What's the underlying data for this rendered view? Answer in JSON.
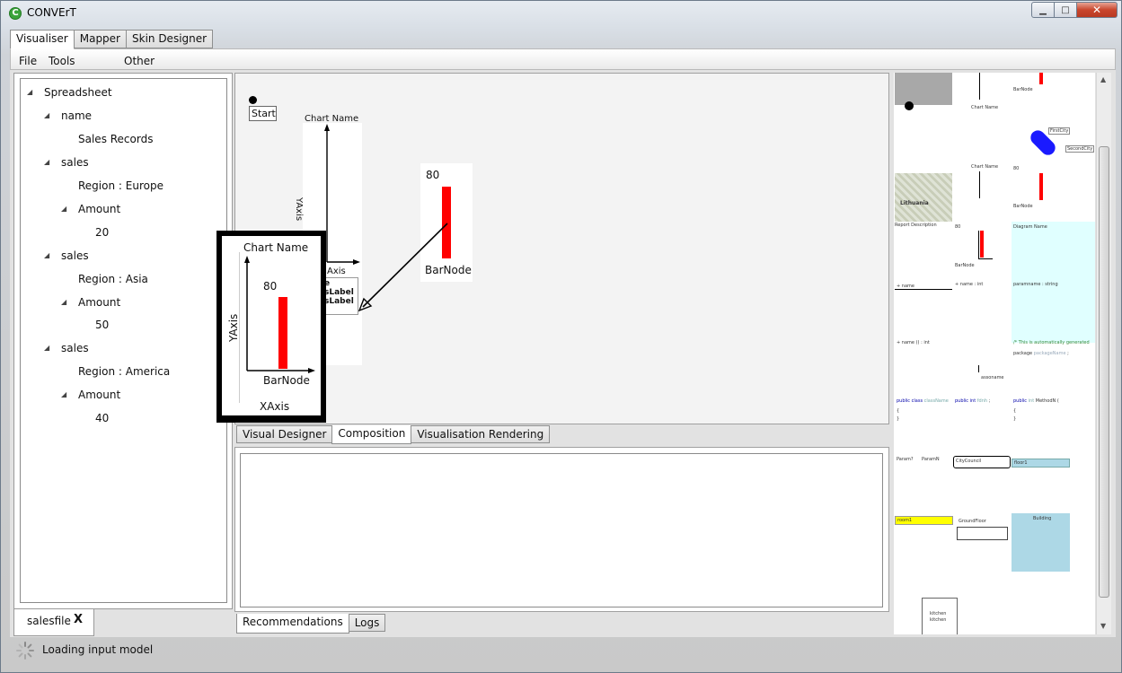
{
  "window": {
    "title": "CONVErT",
    "app_icon": "C"
  },
  "top_tabs": [
    {
      "label": "Visualiser"
    },
    {
      "label": "Mapper"
    },
    {
      "label": "Skin Designer"
    }
  ],
  "menu": [
    {
      "label": "File"
    },
    {
      "label": "Tools"
    },
    {
      "label": "Other"
    }
  ],
  "tree": {
    "root": "Spreadsheet",
    "name_key": "name",
    "name_value": "Sales Records",
    "groups": [
      {
        "key": "sales",
        "region": "Region : Europe",
        "amount_key": "Amount",
        "amount": "20"
      },
      {
        "key": "sales",
        "region": "Region : Asia",
        "amount_key": "Amount",
        "amount": "50"
      },
      {
        "key": "sales",
        "region": "Region : America",
        "amount_key": "Amount",
        "amount": "40"
      }
    ]
  },
  "file_tab": {
    "label": "salesfile",
    "close": "X"
  },
  "designer": {
    "start_label": "Start",
    "chart_bg": {
      "title": "Chart Name",
      "yaxis": "YAxis",
      "xaxis_partial": "Axis",
      "frag1": "e",
      "frag2": "sLabel",
      "frag3": "sLabel"
    },
    "barnode": {
      "value": "80",
      "label": "BarNode",
      "bar_value": 80
    },
    "chart_fg": {
      "title": "Chart Name",
      "yaxis": "YAxis",
      "xaxis": "XAxis",
      "value": "80",
      "bar_label": "BarNode",
      "bar_value": 80
    }
  },
  "mid_tabs": [
    {
      "label": "Visual Designer"
    },
    {
      "label": "Composition"
    },
    {
      "label": "Visualisation Rendering"
    }
  ],
  "bottom_tabs": [
    {
      "label": "Recommendations"
    },
    {
      "label": "Logs"
    }
  ],
  "status": {
    "text": "Loading input model"
  },
  "palette": {
    "chart_name": "Chart Name",
    "bar_node": "BarNode",
    "bar_value": "80",
    "first_city": "FirstCity",
    "second_city": "SecondCity",
    "map_label": "Lithuania",
    "report_desc": "Report Description",
    "diagram_name": "Diagram Name",
    "uml1": [
      "+",
      "name"
    ],
    "uml2": [
      "+",
      "name",
      ":",
      "int"
    ],
    "uml3": [
      "paramname",
      ":",
      "string"
    ],
    "uml4": [
      "+",
      "name",
      "(",
      ")",
      ":",
      "int"
    ],
    "comment": "/* This is automatically generated",
    "package_line": [
      "package",
      "packageName",
      ";"
    ],
    "assoc": "assoname",
    "code1": [
      "public",
      "class",
      "className"
    ],
    "code2": [
      "public",
      "int",
      "fdnh",
      ";"
    ],
    "code3": [
      "public",
      "int",
      "MethodN",
      "("
    ],
    "code_brace_open": "{",
    "code_brace_close": "}",
    "params": [
      "Param?",
      "ParamN"
    ],
    "city_council": "CityCouncil",
    "floor1": "floor1",
    "room1": "room1",
    "ground_floor": "GroundFloor",
    "building": "Building",
    "kitchen1": "kitchen",
    "kitchen2": "kitchen",
    "colors": {
      "bar": "#ff0000",
      "blue": "#1a1aff",
      "lightblue": "#add8e6",
      "cyan": "#e0ffff",
      "yellow": "#ffff00"
    }
  }
}
